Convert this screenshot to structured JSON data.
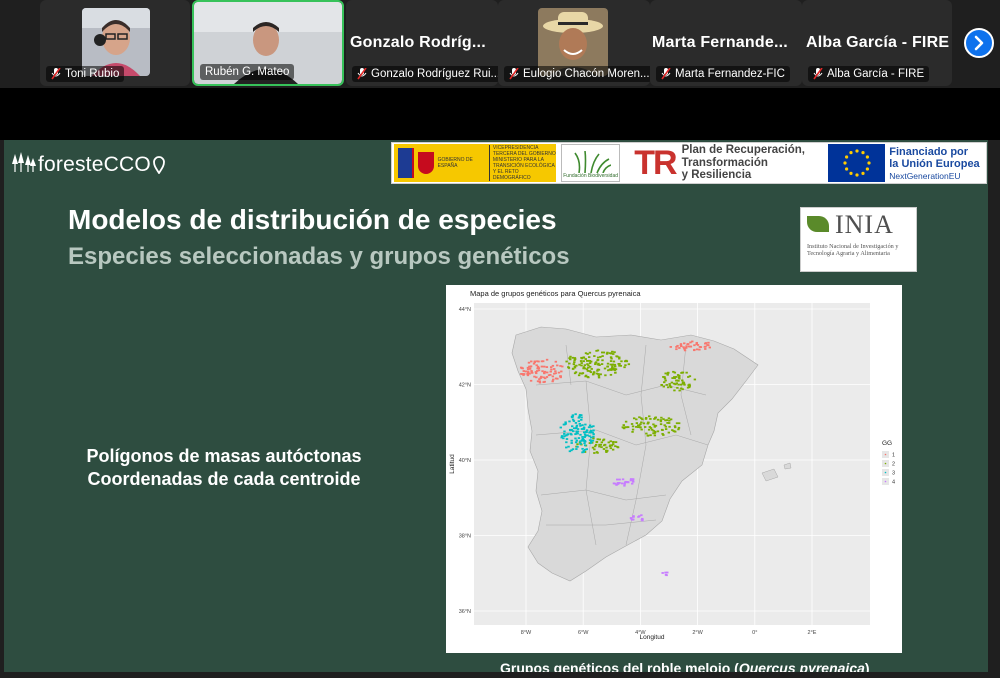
{
  "participants": [
    {
      "name": "Toni Rubio",
      "muted": true,
      "video": true
    },
    {
      "name": "Rubén G. Mateo",
      "muted": false,
      "video": true,
      "active_speaker": true
    },
    {
      "display_name": "Gonzalo Rodríg...",
      "name": "Gonzalo Rodríguez Rui...",
      "muted": true,
      "video": false
    },
    {
      "name": "Eulogio Chacón Moren...",
      "muted": true,
      "video": true
    },
    {
      "display_name": "Marta  Fernande...",
      "name": "Marta Fernandez-FIC",
      "muted": true,
      "video": false
    },
    {
      "display_name": "Alba García - FIRE",
      "name": "Alba García - FIRE",
      "muted": true,
      "video": false
    }
  ],
  "slide": {
    "logo_text": "foresteCCO",
    "sponsors": {
      "gob_text": "GOBIERNO DE ESPAÑA",
      "ministry_text": "VICEPRESIDENCIA TERCERA DEL GOBIERNO MINISTERIO PARA LA TRANSICIÓN ECOLÓGICA Y EL RETO DEMOGRÁFICO",
      "fundacion_text": "Fundación Biodiversidad",
      "prtr_mark": "TR",
      "prtr_lines": [
        "Plan de Recuperación,",
        "Transformación",
        "y Resiliencia"
      ],
      "eu_lines": [
        "Financiado por",
        "la Unión Europea"
      ],
      "eu_sub": "NextGenerationEU"
    },
    "title": "Modelos de distribución de especies",
    "subtitle": "Especies seleccionadas y grupos genéticos",
    "inia": {
      "name": "INIA",
      "desc": "Instituto Nacional de Investigación y Tecnología Agraria y Alimentaria"
    },
    "bullets": [
      "Polígonos de masas autóctonas",
      "Coordenadas de cada centroide"
    ],
    "caption_prefix": "Grupos genéticos del roble melojo (",
    "caption_italic": "Quercus pyrenaica",
    "caption_suffix": ")"
  },
  "map": {
    "title": "Mapa de grupos genéticos para Quercus pyrenaica",
    "xlabel": "Longitud",
    "ylabel": "Latitud",
    "x_ticks": [
      "8°W",
      "6°W",
      "4°W",
      "2°W",
      "0°",
      "2°E"
    ],
    "y_ticks": [
      "44°N",
      "42°N",
      "40°N",
      "38°N",
      "36°N"
    ],
    "legend_title": "GG",
    "legend": [
      {
        "label": "1",
        "color": "#f8766d"
      },
      {
        "label": "2",
        "color": "#7cae00"
      },
      {
        "label": "3",
        "color": "#00bfc4"
      },
      {
        "label": "4",
        "color": "#c77cff"
      }
    ]
  }
}
